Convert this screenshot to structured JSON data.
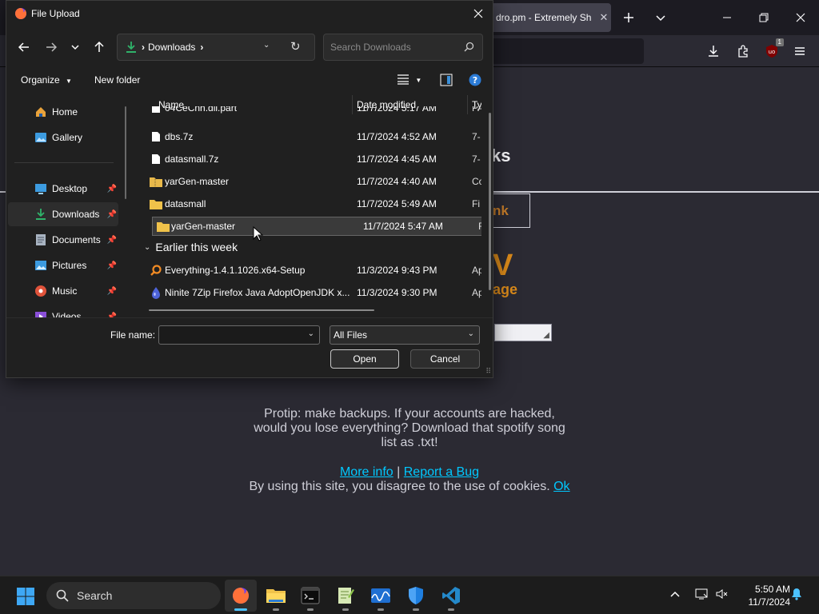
{
  "browser": {
    "active_tab_title": "dro.pm - Extremely Sh",
    "page": {
      "heading_fragment": "ks",
      "link_fragment": "nk",
      "big_letter": "V",
      "big_sub": "age",
      "protip": "Protip: make backups. If your accounts are hacked, would you lose everything? Download that spotify song list as .txt!",
      "more_info": "More info",
      "separator": "|",
      "report_bug": "Report a Bug",
      "cookie_text": "By using this site, you disagree to the use of cookies.",
      "cookie_ok": "Ok"
    },
    "extension_badge": "1"
  },
  "dialog": {
    "title": "File Upload",
    "address": {
      "location": "Downloads"
    },
    "search_placeholder": "Search Downloads",
    "commands": {
      "organize": "Organize",
      "new_folder": "New folder"
    },
    "nav": {
      "home": "Home",
      "gallery": "Gallery",
      "desktop": "Desktop",
      "downloads": "Downloads",
      "documents": "Documents",
      "pictures": "Pictures",
      "music": "Music",
      "videos": "Videos"
    },
    "columns": {
      "name": "Name",
      "date": "Date modified",
      "type": "Ty"
    },
    "files": [
      {
        "name": "04CeCnh.dll.part",
        "date": "11/7/2024 5:17 AM",
        "type": "PA",
        "icon": "file-icon"
      },
      {
        "name": "dbs.7z",
        "date": "11/7/2024 4:52 AM",
        "type": "7-",
        "icon": "file-icon"
      },
      {
        "name": "datasmall.7z",
        "date": "11/7/2024 4:45 AM",
        "type": "7-",
        "icon": "file-icon"
      },
      {
        "name": "yarGen-master",
        "date": "11/7/2024 4:40 AM",
        "type": "Co",
        "icon": "zip-folder-icon"
      },
      {
        "name": "datasmall",
        "date": "11/7/2024 5:49 AM",
        "type": "Fi",
        "icon": "folder-icon"
      },
      {
        "name": "yarGen-master",
        "date": "11/7/2024 5:47 AM",
        "type": "Fi",
        "icon": "folder-icon"
      }
    ],
    "group_earlier": "Earlier this week",
    "files_earlier": [
      {
        "name": "Everything-1.4.1.1026.x64-Setup",
        "date": "11/3/2024 9:43 PM",
        "type": "Ap",
        "icon": "everything-app-icon"
      },
      {
        "name": "Ninite 7Zip Firefox Java AdoptOpenJDK x...",
        "date": "11/3/2024 9:30 PM",
        "type": "Ap",
        "icon": "ninite-app-icon"
      }
    ],
    "file_name_label": "File name:",
    "file_name_value": "",
    "filter": "All Files",
    "open_label": "Open",
    "cancel_label": "Cancel"
  },
  "taskbar": {
    "search_label": "Search",
    "time": "5:50 AM",
    "date": "11/7/2024"
  },
  "colors": {
    "accent": "#4cc2ff",
    "link": "#00c8ff",
    "orange": "#d9891a",
    "downloads_green": "#2fb36a"
  }
}
